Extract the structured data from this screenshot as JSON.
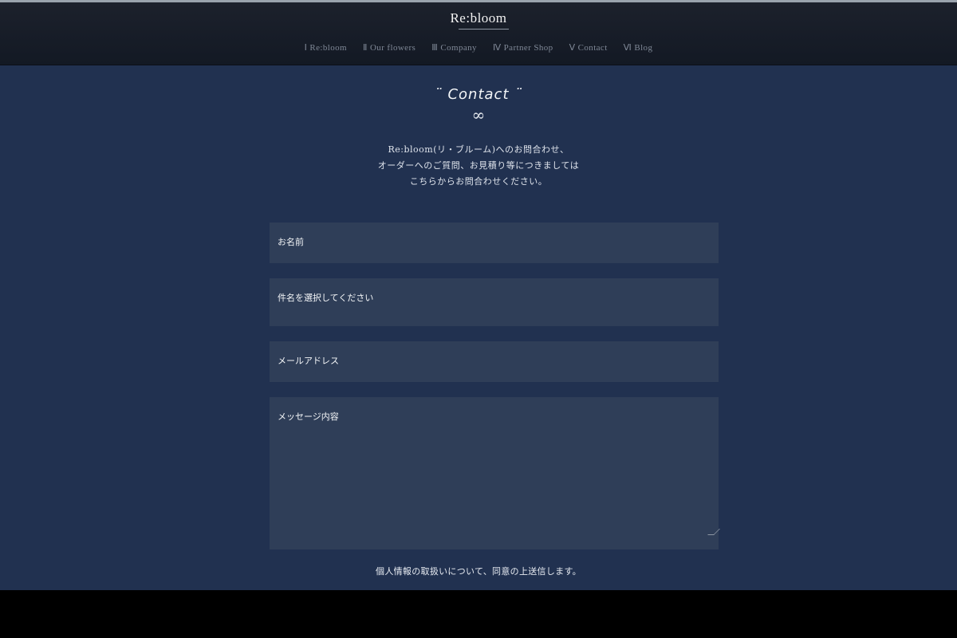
{
  "header": {
    "logo": "Re:bloom",
    "nav": [
      "Ⅰ Re:bloom",
      "Ⅱ Our flowers",
      "Ⅲ Company",
      "Ⅳ Partner Shop",
      "Ⅴ Contact",
      "Ⅵ Blog"
    ]
  },
  "main": {
    "heading": "¨ Contact ¨",
    "ornament": "∞",
    "intro": [
      "Re:bloom(リ・ブルーム)へのお問合わせ、",
      "オーダーへのご質問、お見積り等につきましては",
      "こちらからお問合わせください。"
    ],
    "form": {
      "name_placeholder": "お名前",
      "subject_placeholder": "件名を選択してください",
      "email_placeholder": "メールアドレス",
      "message_placeholder": "メッセージ内容"
    },
    "consent": "個人情報の取扱いについて、同意の上送信します。"
  },
  "colors": {
    "header_bg": "#161c27",
    "main_bg": "#213150",
    "field_bg": "#2f3e58",
    "nav_text": "#7f8896"
  }
}
